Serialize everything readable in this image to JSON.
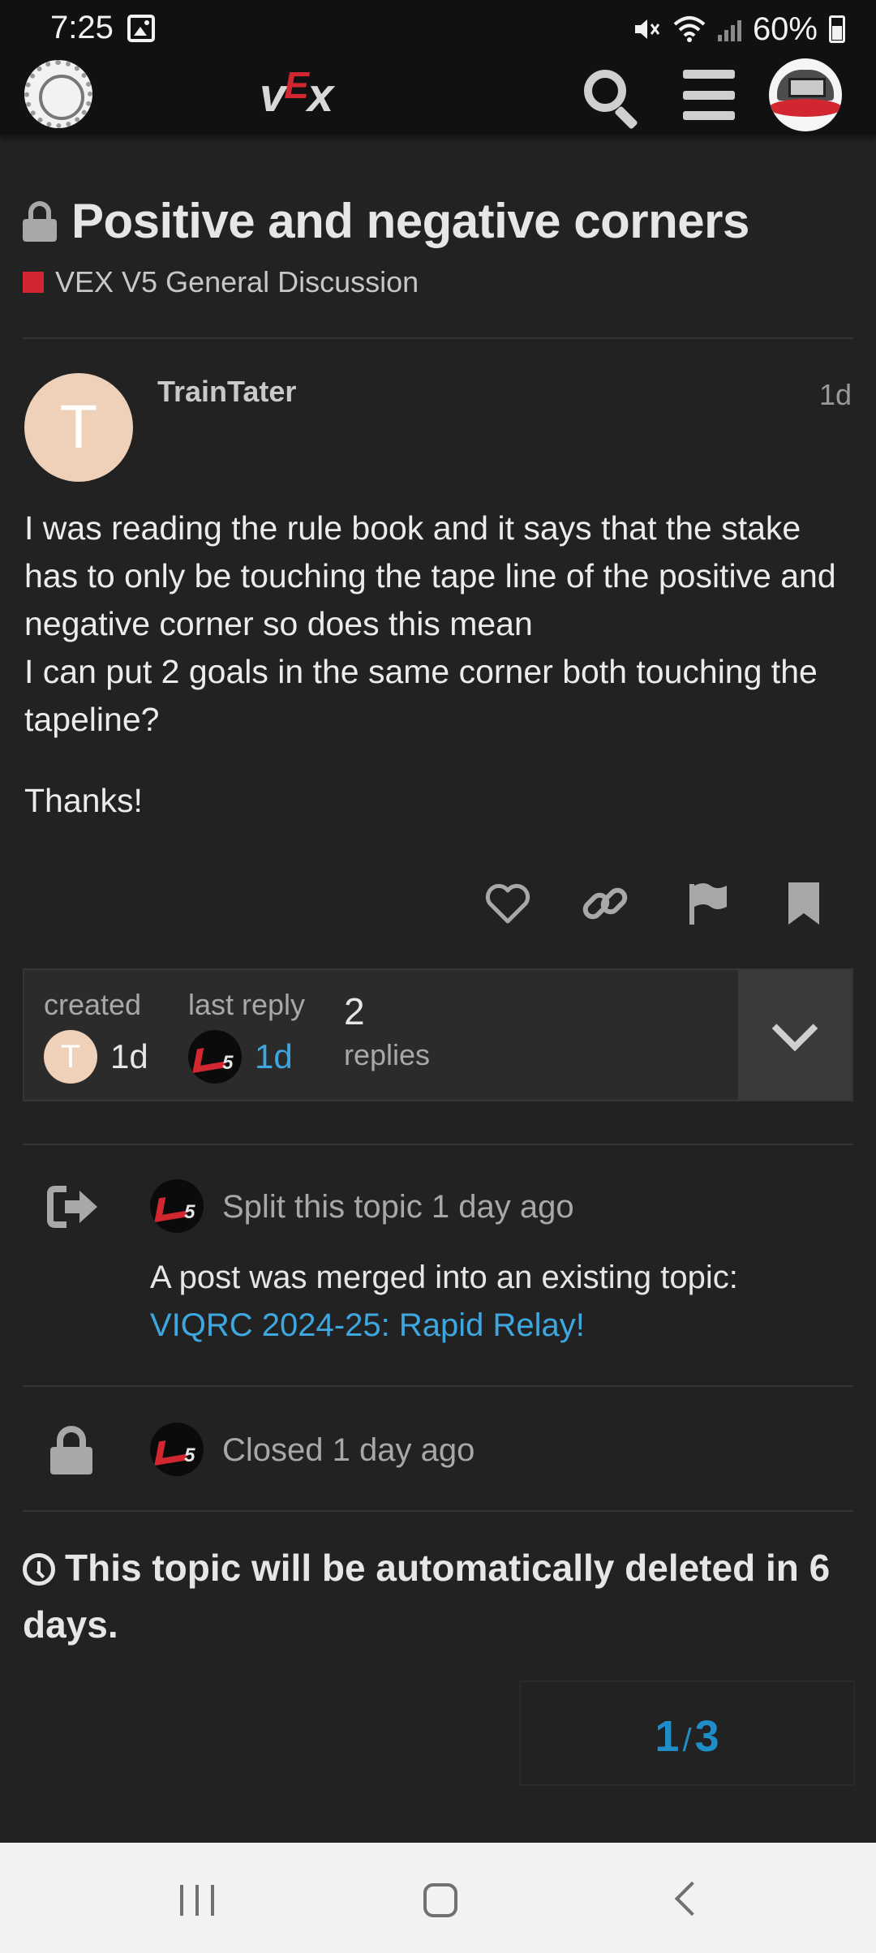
{
  "status_bar": {
    "time": "7:25",
    "battery": "60%"
  },
  "header": {
    "wordmark_v": "v",
    "wordmark_e": "E",
    "wordmark_x": "x"
  },
  "topic": {
    "title": "Positive and negative corners",
    "category": "VEX V5 General Discussion",
    "category_color": "#d22730"
  },
  "post": {
    "avatar_letter": "T",
    "author": "TrainTater",
    "age": "1d",
    "body_line_1": "I was reading the rule book and it says that the stake has to only be touching the tape line of the positive and negative corner so does this mean",
    "body_line_2": "I can put 2 goals in the same corner both touching the tapeline?",
    "body_line_3": "Thanks!"
  },
  "topic_map": {
    "created_label": "created",
    "created_avatar_letter": "T",
    "created_value": "1d",
    "last_reply_label": "last reply",
    "last_reply_value": "1d",
    "replies_count": "2",
    "replies_label": "replies"
  },
  "small_actions": [
    {
      "text": "Split this topic 1 day ago",
      "description": "A post was merged into an existing topic:",
      "link": "VIQRC 2024-25: Rapid Relay!"
    },
    {
      "text": "Closed 1 day ago"
    }
  ],
  "notice": {
    "text": "This topic will be automatically deleted in 6 days."
  },
  "progress": {
    "current": "1",
    "separator": "/",
    "total": "3"
  },
  "colors": {
    "accent": "#d22730",
    "link": "#3ea7e0",
    "background": "#222222"
  }
}
